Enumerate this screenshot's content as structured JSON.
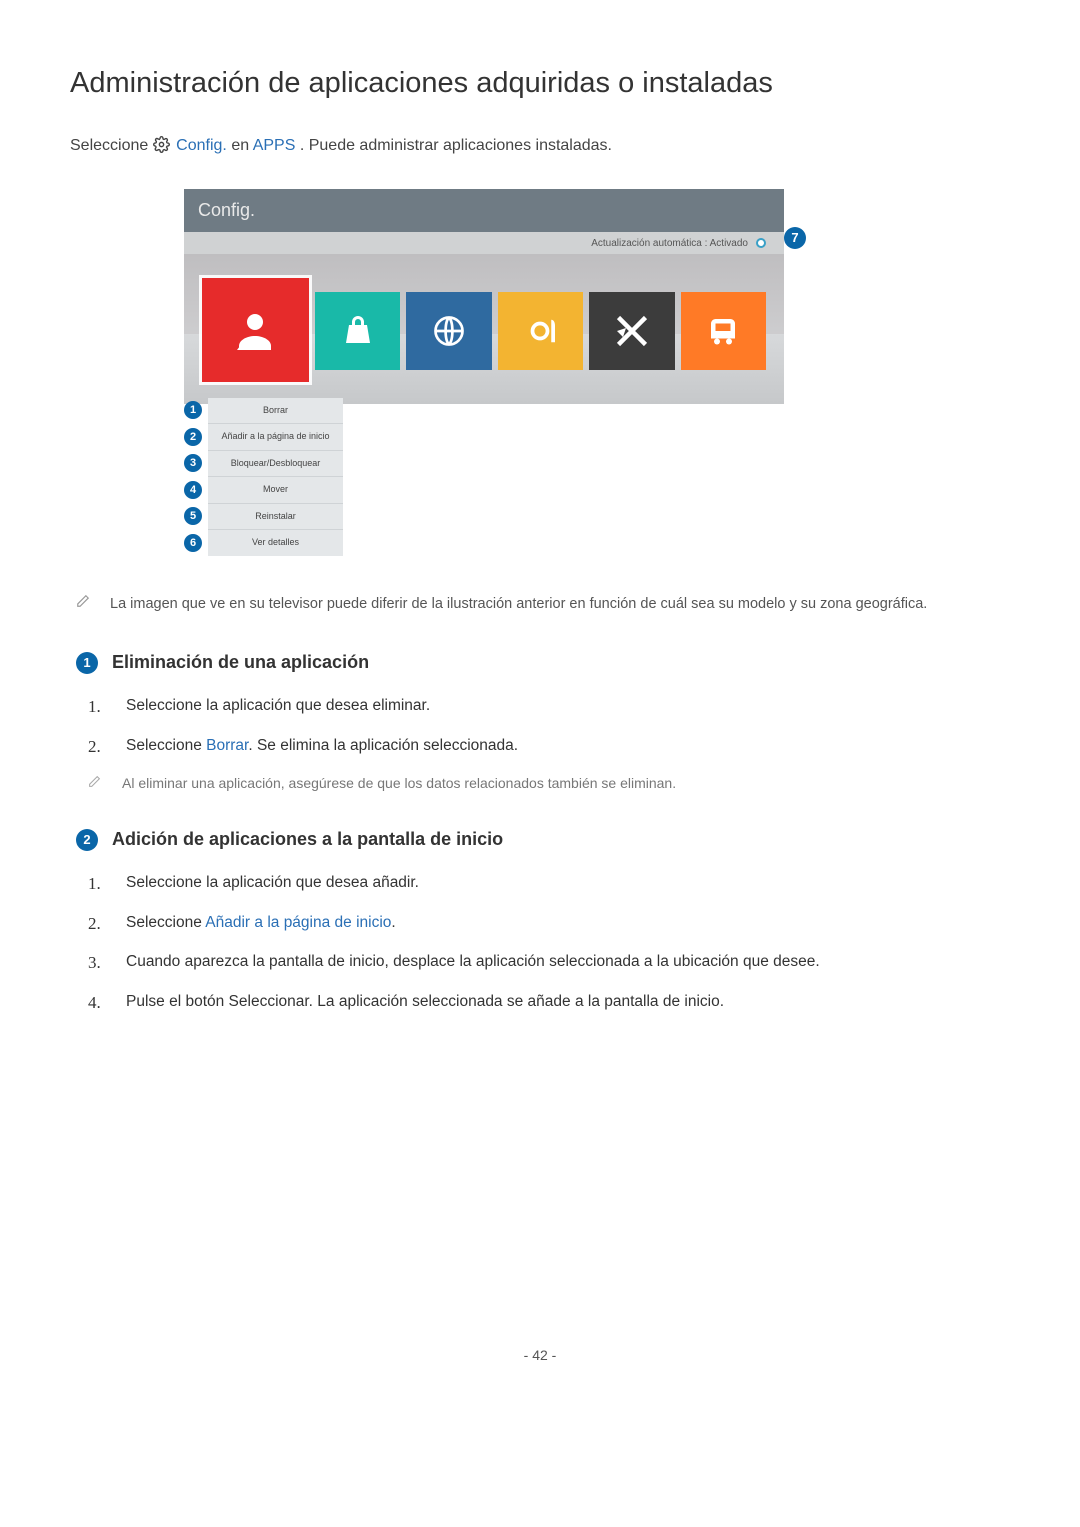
{
  "page_number": "- 42 -",
  "title": "Administración de aplicaciones adquiridas o instaladas",
  "intro": {
    "prefix": "Seleccione ",
    "config": "Config.",
    "mid": " en ",
    "apps": "APPS",
    "suffix": ". Puede administrar aplicaciones instaladas."
  },
  "tv": {
    "header": "Config.",
    "auto_update": "Actualización automática : Activado",
    "badge7": "7",
    "menu": [
      {
        "n": "1",
        "label": "Borrar"
      },
      {
        "n": "2",
        "label": "Añadir a la página de inicio"
      },
      {
        "n": "3",
        "label": "Bloquear/Desbloquear"
      },
      {
        "n": "4",
        "label": "Mover"
      },
      {
        "n": "5",
        "label": "Reinstalar"
      },
      {
        "n": "6",
        "label": "Ver detalles"
      }
    ]
  },
  "img_note": "La imagen que ve en su televisor puede diferir de la ilustración anterior en función de cuál sea su modelo y su zona geográfica.",
  "sections": [
    {
      "num": "1",
      "title": "Eliminación de una aplicación",
      "steps": [
        {
          "n": "1.",
          "text": "Seleccione la aplicación que desea eliminar."
        },
        {
          "n": "2.",
          "pre": "Seleccione ",
          "blue": "Borrar",
          "post": ". Se elimina la aplicación seleccionada."
        }
      ],
      "note": "Al eliminar una aplicación, asegúrese de que los datos relacionados también se eliminan."
    },
    {
      "num": "2",
      "title": "Adición de aplicaciones a la pantalla de inicio",
      "steps": [
        {
          "n": "1.",
          "text": "Seleccione la aplicación que desea añadir."
        },
        {
          "n": "2.",
          "pre": "Seleccione ",
          "blue": "Añadir a la página de inicio",
          "post": "."
        },
        {
          "n": "3.",
          "text": "Cuando aparezca la pantalla de inicio, desplace la aplicación seleccionada a la ubicación que desee."
        },
        {
          "n": "4.",
          "text": "Pulse el botón Seleccionar. La aplicación seleccionada se añade a la pantalla de inicio."
        }
      ]
    }
  ]
}
